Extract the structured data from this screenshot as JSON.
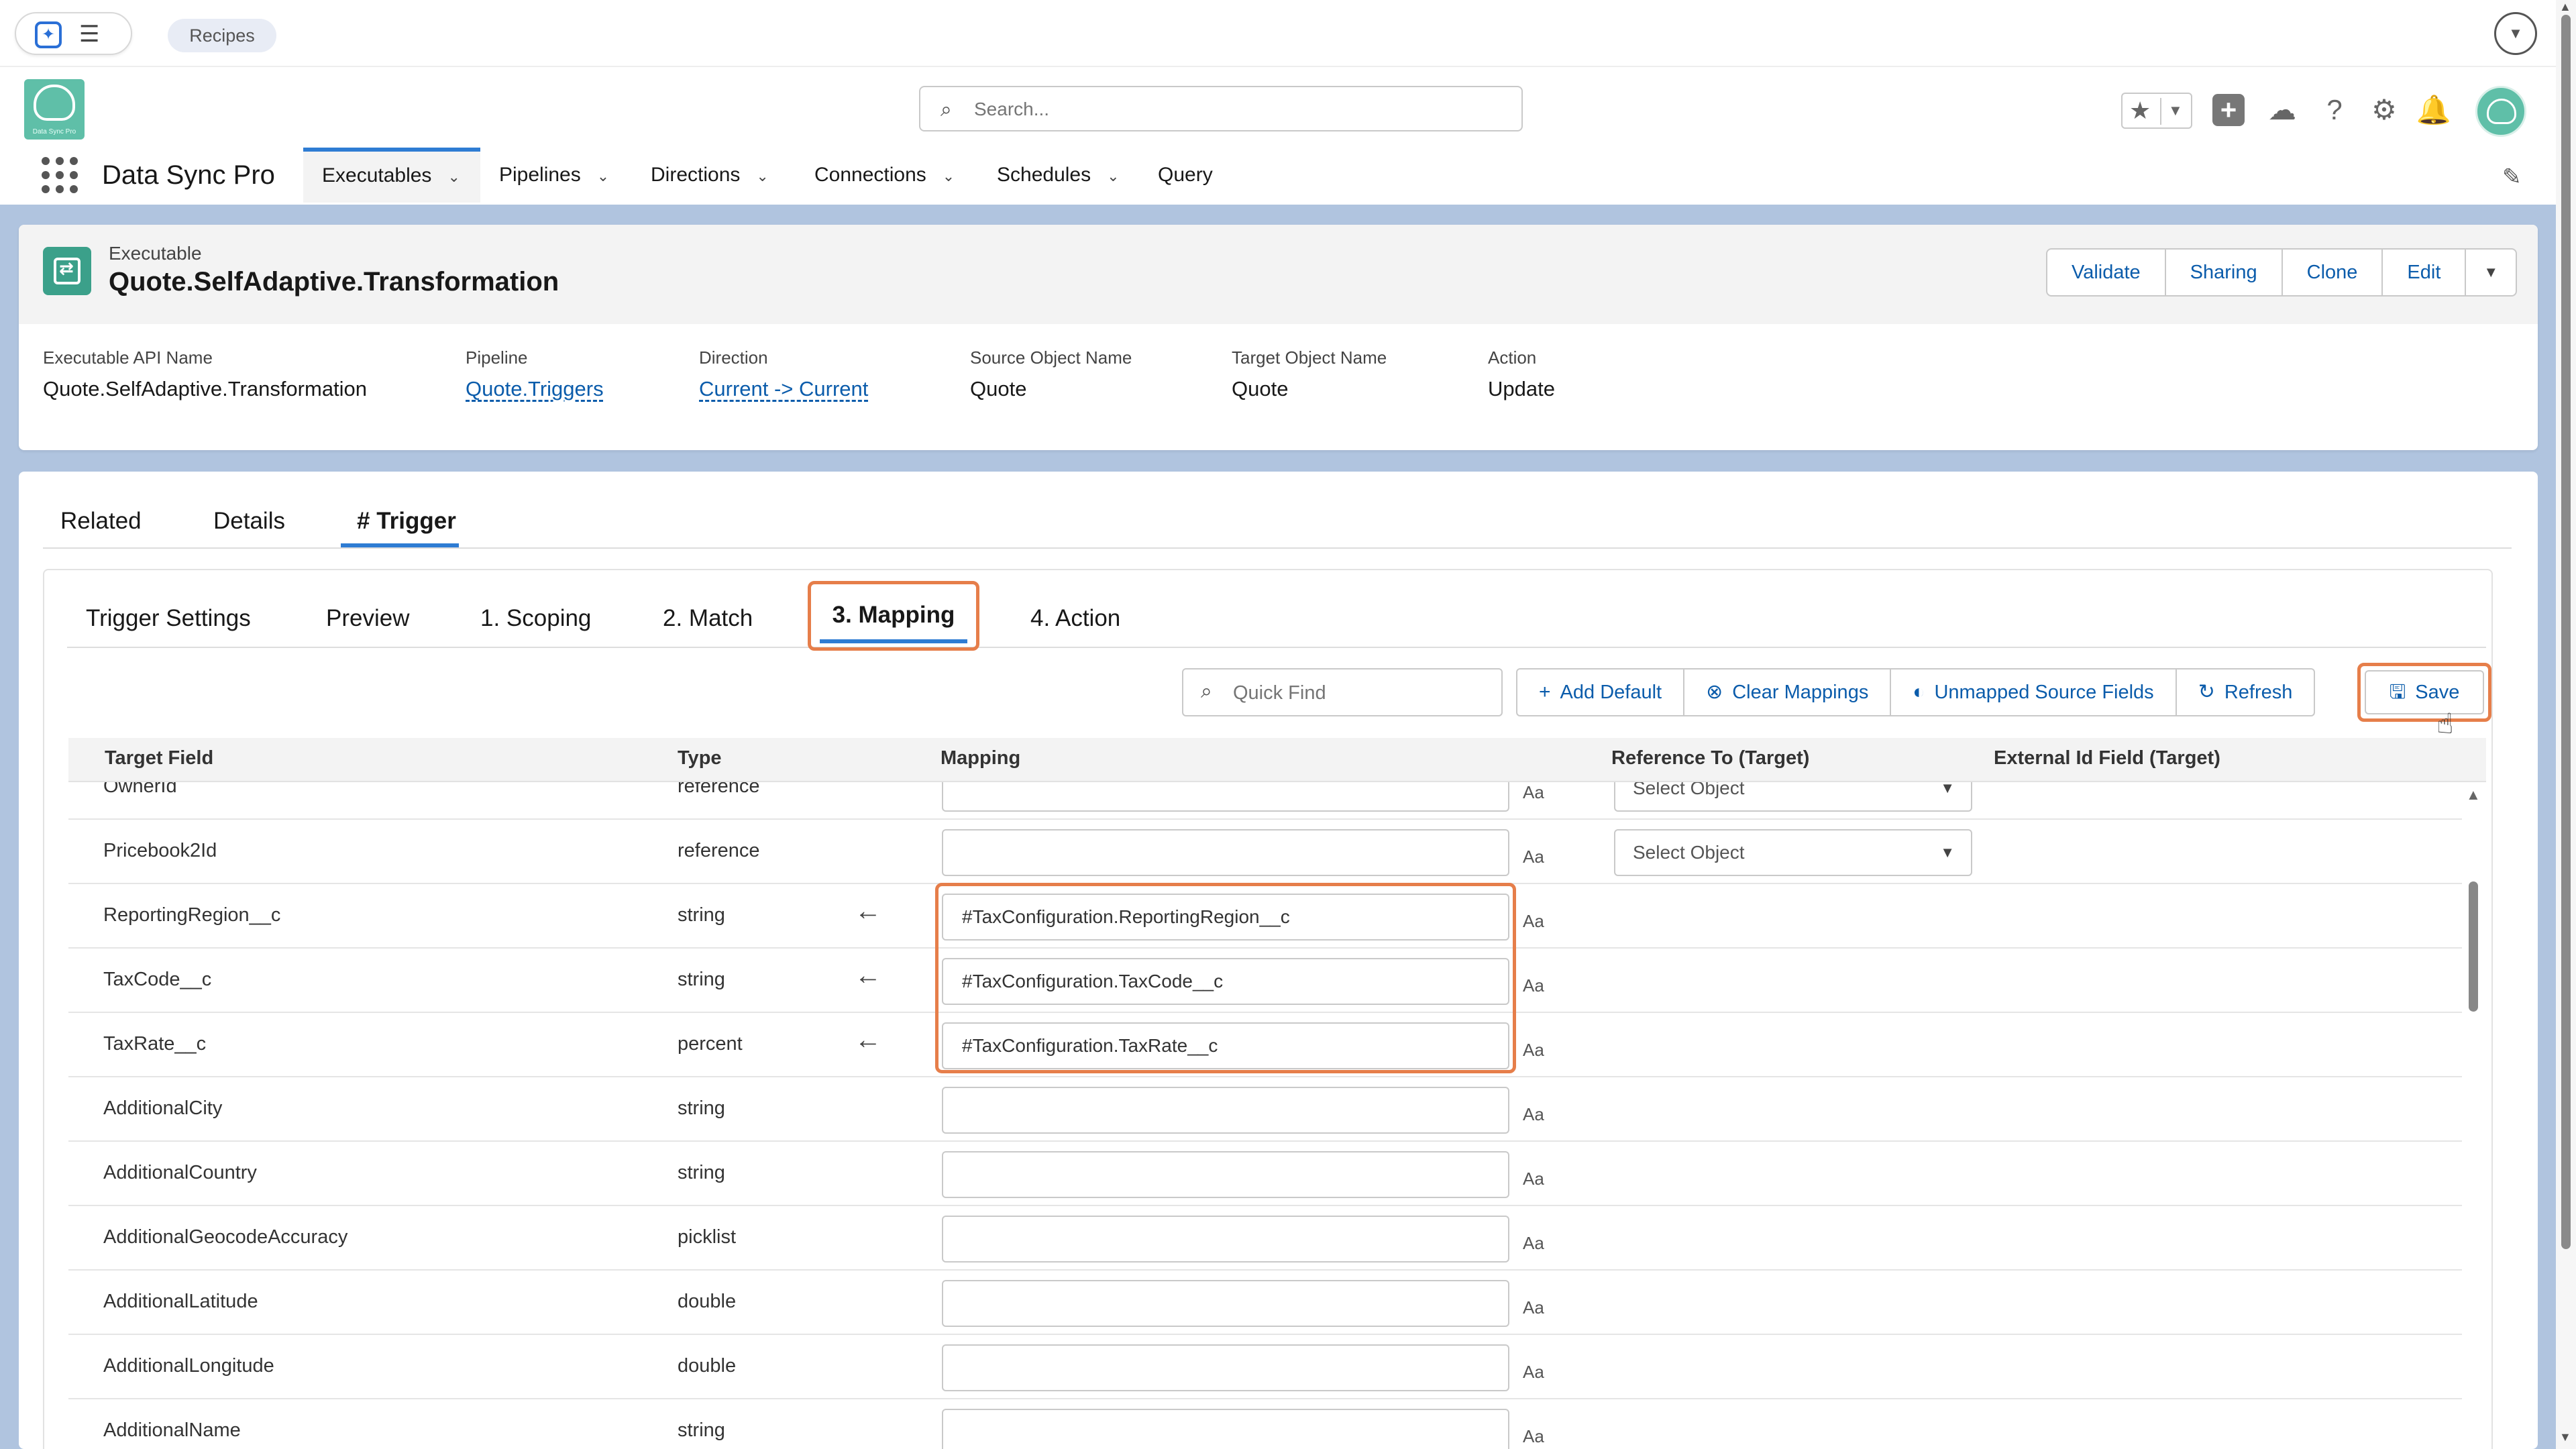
{
  "browser": {
    "recipes_chip": "Recipes",
    "app_icon": "sparkle-app-icon",
    "menu_icon": "hamburger-icon",
    "expand_icon": "chevron-down-icon"
  },
  "header": {
    "search_placeholder": "Search...",
    "logo_text": "Data Sync Pro"
  },
  "nav": {
    "app_name": "Data Sync Pro",
    "tabs": [
      {
        "label": "Executables"
      },
      {
        "label": "Pipelines"
      },
      {
        "label": "Directions"
      },
      {
        "label": "Connections"
      },
      {
        "label": "Schedules"
      },
      {
        "label": "Query"
      }
    ]
  },
  "record": {
    "type": "Executable",
    "title": "Quote.SelfAdaptive.Transformation",
    "actions": [
      "Validate",
      "Sharing",
      "Clone",
      "Edit"
    ],
    "fields": [
      {
        "label": "Executable API Name",
        "value": "Quote.SelfAdaptive.Transformation"
      },
      {
        "label": "Pipeline",
        "value": "Quote.Triggers"
      },
      {
        "label": "Direction",
        "value": "Current -> Current"
      },
      {
        "label": "Source Object Name",
        "value": "Quote"
      },
      {
        "label": "Target Object Name",
        "value": "Quote"
      },
      {
        "label": "Action",
        "value": "Update"
      }
    ]
  },
  "tabs": [
    "Related",
    "Details",
    "# Trigger"
  ],
  "subtabs": [
    "Trigger Settings",
    "Preview",
    "1. Scoping",
    "2. Match",
    "3. Mapping",
    "4. Action"
  ],
  "toolbar": {
    "quick_find_placeholder": "Quick Find",
    "add_default": "Add Default",
    "clear_mappings": "Clear Mappings",
    "unmapped_source_fields": "Unmapped Source Fields",
    "refresh": "Refresh",
    "save": "Save"
  },
  "table": {
    "headers": [
      "Target Field",
      "Type",
      "Mapping",
      "Reference To (Target)",
      "External Id Field (Target)"
    ],
    "ref_placeholder": "Select Object",
    "text_type_label": "Aa",
    "rows": [
      {
        "field": "OwnerId",
        "type": "reference",
        "mapping": "",
        "ref": "Select Object",
        "arrow": false
      },
      {
        "field": "Pricebook2Id",
        "type": "reference",
        "mapping": "",
        "ref": "Select Object",
        "arrow": false
      },
      {
        "field": "ReportingRegion__c",
        "type": "string",
        "mapping": "#TaxConfiguration.ReportingRegion__c",
        "ref": null,
        "arrow": true
      },
      {
        "field": "TaxCode__c",
        "type": "string",
        "mapping": "#TaxConfiguration.TaxCode__c",
        "ref": null,
        "arrow": true
      },
      {
        "field": "TaxRate__c",
        "type": "percent",
        "mapping": "#TaxConfiguration.TaxRate__c",
        "ref": null,
        "arrow": true
      },
      {
        "field": "AdditionalCity",
        "type": "string",
        "mapping": "",
        "ref": null,
        "arrow": false
      },
      {
        "field": "AdditionalCountry",
        "type": "string",
        "mapping": "",
        "ref": null,
        "arrow": false
      },
      {
        "field": "AdditionalGeocodeAccuracy",
        "type": "picklist",
        "mapping": "",
        "ref": null,
        "arrow": false
      },
      {
        "field": "AdditionalLatitude",
        "type": "double",
        "mapping": "",
        "ref": null,
        "arrow": false
      },
      {
        "field": "AdditionalLongitude",
        "type": "double",
        "mapping": "",
        "ref": null,
        "arrow": false
      },
      {
        "field": "AdditionalName",
        "type": "string",
        "mapping": "",
        "ref": null,
        "arrow": false
      }
    ]
  },
  "colors": {
    "highlight": "#e67e4a",
    "link": "#0b5cab",
    "active_tab": "#2e7cd3",
    "page_bg": "#b0c4df"
  }
}
